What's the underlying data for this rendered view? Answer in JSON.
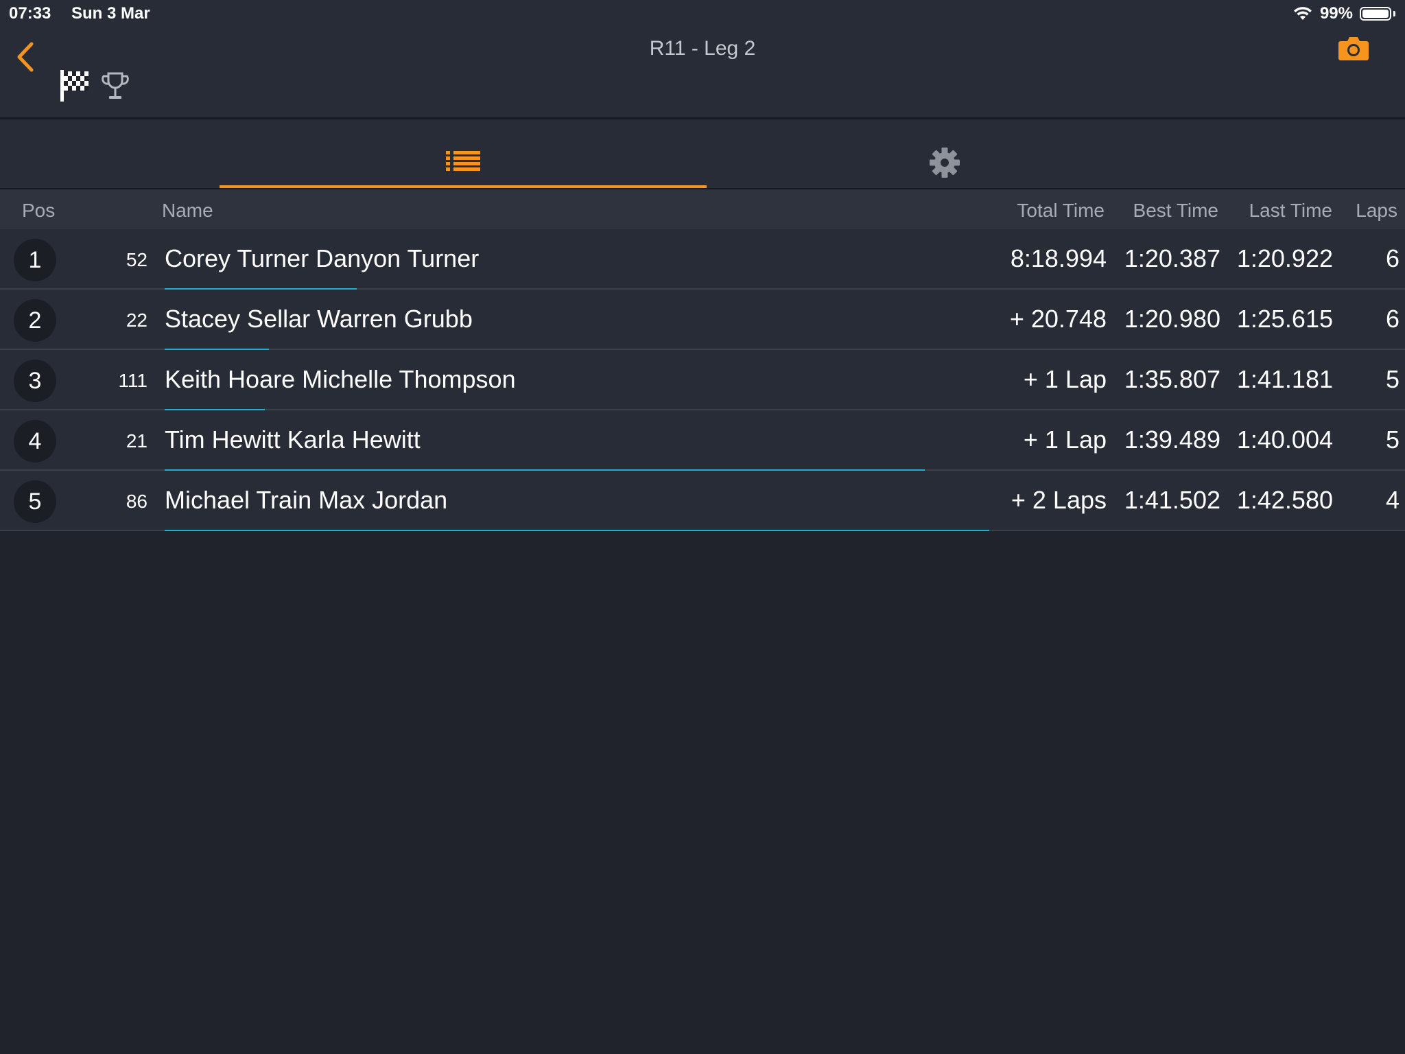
{
  "status_bar": {
    "time": "07:33",
    "date": "Sun 3 Mar",
    "battery_percent": "99%",
    "battery_level": 0.99
  },
  "header": {
    "title": "R11 - Leg 2",
    "icons": [
      "back-chevron-icon",
      "checkered-flag-icon",
      "trophy-icon",
      "camera-icon"
    ],
    "accent_color": "#f7941d"
  },
  "tabs": [
    {
      "icon": "list-icon",
      "active": true
    },
    {
      "icon": "gear-icon",
      "active": false
    }
  ],
  "table": {
    "columns": {
      "pos": "Pos",
      "name": "Name",
      "total": "Total Time",
      "best": "Best Time",
      "last": "Last Time",
      "laps": "Laps"
    },
    "progress_color": "#17b3d6",
    "rows": [
      {
        "pos": "1",
        "num": "52",
        "name": "Corey Turner Danyon Turner",
        "total": "8:18.994",
        "best": "1:20.387",
        "last": "1:20.922",
        "laps": "6",
        "progress": 0.155
      },
      {
        "pos": "2",
        "num": "22",
        "name": "Stacey Sellar Warren Grubb",
        "total": "+ 20.748",
        "best": "1:20.980",
        "last": "1:25.615",
        "laps": "6",
        "progress": 0.084
      },
      {
        "pos": "3",
        "num": "111",
        "name": "Keith Hoare Michelle Thompson",
        "total": "+ 1 Lap",
        "best": "1:35.807",
        "last": "1:41.181",
        "laps": "5",
        "progress": 0.081
      },
      {
        "pos": "4",
        "num": "21",
        "name": "Tim Hewitt Karla Hewitt",
        "total": "+ 1 Lap",
        "best": "1:39.489",
        "last": "1:40.004",
        "laps": "5",
        "progress": 0.613
      },
      {
        "pos": "5",
        "num": "86",
        "name": "Michael Train Max Jordan",
        "total": "+ 2 Laps",
        "best": "1:41.502",
        "last": "1:42.580",
        "laps": "4",
        "progress": 0.665
      }
    ]
  }
}
